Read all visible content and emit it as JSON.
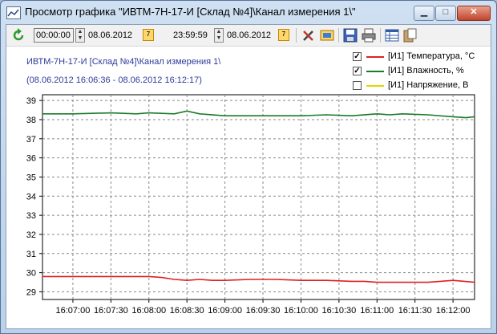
{
  "window": {
    "title": "Просмотр графика \"ИВТМ-7Н-17-И [Склад №4]\\Канал измерения 1\\\""
  },
  "toolbar": {
    "start_time": "00:00:00",
    "start_date": "08.06.2012",
    "end_time": "23:59:59",
    "end_date": "08.06.2012",
    "calendar_label": "7"
  },
  "header": {
    "device_title": "ИВТМ-7Н-17-И [Склад №4]\\Канал измерения 1\\",
    "range": "(08.06.2012 16:06:36 - 08.06.2012 16:12:17)"
  },
  "legend": [
    {
      "label": "[И1] Температура, °С",
      "color": "#e02020",
      "checked": true,
      "mark": "✓"
    },
    {
      "label": "[И1] Влажность, %",
      "color": "#1a7a2a",
      "checked": true,
      "mark": "✓"
    },
    {
      "label": "[И1] Напряжение, В",
      "color": "#e8d400",
      "checked": false,
      "mark": ""
    }
  ],
  "chart_data": {
    "type": "line",
    "x_ticks": [
      "16:07:00",
      "16:07:30",
      "16:08:00",
      "16:08:30",
      "16:09:00",
      "16:09:30",
      "16:10:00",
      "16:10:30",
      "16:11:00",
      "16:11:30",
      "16:12:00"
    ],
    "y_ticks": [
      29,
      30,
      31,
      32,
      33,
      34,
      35,
      36,
      37,
      38,
      39
    ],
    "ylim": [
      28.6,
      39.3
    ],
    "xlim": [
      "16:06:36",
      "16:12:17"
    ],
    "grid": true,
    "series": [
      {
        "name": "[И1] Температура, °С",
        "color": "#e02020",
        "x": [
          "16:06:36",
          "16:07:00",
          "16:07:30",
          "16:08:00",
          "16:08:10",
          "16:08:20",
          "16:08:30",
          "16:08:40",
          "16:08:50",
          "16:09:00",
          "16:09:20",
          "16:09:40",
          "16:10:00",
          "16:10:20",
          "16:10:40",
          "16:10:50",
          "16:11:00",
          "16:11:20",
          "16:11:40",
          "16:11:50",
          "16:12:00",
          "16:12:17"
        ],
        "y": [
          29.8,
          29.8,
          29.8,
          29.8,
          29.75,
          29.65,
          29.6,
          29.65,
          29.6,
          29.6,
          29.65,
          29.65,
          29.6,
          29.6,
          29.55,
          29.55,
          29.5,
          29.5,
          29.5,
          29.55,
          29.6,
          29.5
        ]
      },
      {
        "name": "[И1] Влажность, %",
        "color": "#1a7a2a",
        "x": [
          "16:06:36",
          "16:07:00",
          "16:07:30",
          "16:07:50",
          "16:08:00",
          "16:08:20",
          "16:08:30",
          "16:08:40",
          "16:09:00",
          "16:09:20",
          "16:09:40",
          "16:10:00",
          "16:10:20",
          "16:10:40",
          "16:11:00",
          "16:11:10",
          "16:11:20",
          "16:11:40",
          "16:12:00",
          "16:12:10",
          "16:12:17"
        ],
        "y": [
          38.3,
          38.3,
          38.35,
          38.3,
          38.35,
          38.3,
          38.45,
          38.3,
          38.2,
          38.2,
          38.2,
          38.2,
          38.25,
          38.2,
          38.3,
          38.25,
          38.3,
          38.25,
          38.15,
          38.1,
          38.15
        ]
      },
      {
        "name": "[И1] Напряжение, В",
        "color": "#e8d400",
        "visible": false,
        "x": [],
        "y": []
      }
    ]
  }
}
